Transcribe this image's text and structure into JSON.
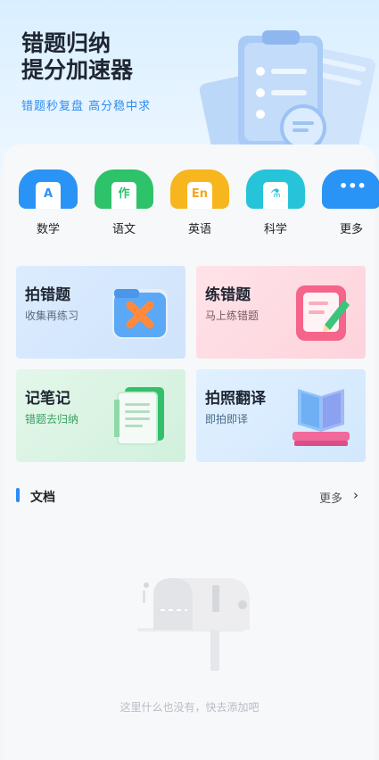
{
  "hero": {
    "title_line1": "错题归纳",
    "title_line2": "提分加速器",
    "subtitle": "错题秒复盘  高分稳中求"
  },
  "subjects": [
    {
      "label": "数学",
      "icon": "math-icon",
      "color": "#2a93f6",
      "glyph": "A"
    },
    {
      "label": "语文",
      "icon": "chinese-icon",
      "color": "#2ec26a",
      "glyph": "作"
    },
    {
      "label": "英语",
      "icon": "english-icon",
      "color": "#f7b51e",
      "glyph": "En"
    },
    {
      "label": "科学",
      "icon": "science-icon",
      "color": "#27c4d9",
      "glyph": "⚗"
    },
    {
      "label": "更多",
      "icon": "more-icon",
      "color": "#2a93f6",
      "glyph": "•••"
    }
  ],
  "tiles": {
    "photo_mistake": {
      "title": "拍错题",
      "subtitle": "收集再练习"
    },
    "practice_mistake": {
      "title": "练错题",
      "subtitle": "马上练错题"
    },
    "notes": {
      "title": "记笔记",
      "subtitle": "错题去归纳"
    },
    "translate": {
      "title": "拍照翻译",
      "subtitle": "即拍即译"
    }
  },
  "documents": {
    "title": "文档",
    "more": "更多",
    "chevron": "›",
    "empty_text": "这里什么也没有，快去添加吧"
  }
}
